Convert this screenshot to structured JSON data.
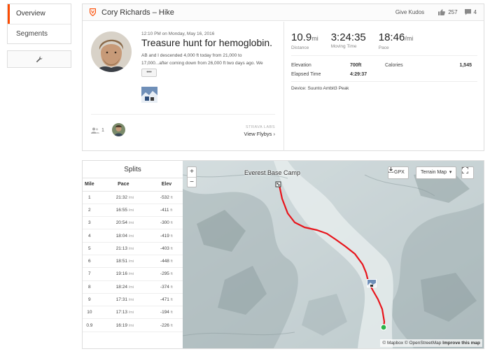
{
  "sidebar": {
    "items": [
      {
        "label": "Overview",
        "active": true
      },
      {
        "label": "Segments",
        "active": false
      }
    ],
    "tool_icon": "wrench-icon"
  },
  "activity": {
    "athlete": "Cory Richards",
    "type": "Hike",
    "title_sep": " – ",
    "kudos_label": "Give Kudos",
    "kudos_count": "257",
    "comment_count": "4",
    "datetime": "12:10 PM on Monday, May 16, 2016",
    "name": "Treasure hunt for hemoglobin.",
    "description_line1": "AB and I descended 4,000 ft today from 21,000 to",
    "description_line2": "17,000...after coming down from 26,000 ft two days ago. We",
    "more_label": "•••",
    "with_count": "1",
    "flyby_lab": "STRAVA LABS",
    "flyby_link": "View Flybys ›"
  },
  "stats": {
    "distance": {
      "value": "10.9",
      "unit": "mi",
      "label": "Distance"
    },
    "moving_time": {
      "value": "3:24:35",
      "label": "Moving Time"
    },
    "pace": {
      "value": "18:46",
      "unit": "/mi",
      "label": "Pace"
    },
    "elevation_label": "Elevation",
    "elevation_value": "700ft",
    "calories_label": "Calories",
    "calories_value": "1,545",
    "elapsed_label": "Elapsed Time",
    "elapsed_value": "4:29:37",
    "device": "Device: Suunto Ambit3 Peak"
  },
  "splits": {
    "title": "Splits",
    "headers": [
      "Mile",
      "Pace",
      "Elev"
    ],
    "pace_unit": "/mi",
    "elev_unit": "ft",
    "rows": [
      {
        "mile": "1",
        "pace": "21:32",
        "elev": "-532"
      },
      {
        "mile": "2",
        "pace": "16:55",
        "elev": "-411"
      },
      {
        "mile": "3",
        "pace": "20:54",
        "elev": "-300"
      },
      {
        "mile": "4",
        "pace": "18:04",
        "elev": "-419"
      },
      {
        "mile": "5",
        "pace": "21:13",
        "elev": "-403"
      },
      {
        "mile": "6",
        "pace": "18:51",
        "elev": "-448"
      },
      {
        "mile": "7",
        "pace": "19:16",
        "elev": "-295"
      },
      {
        "mile": "8",
        "pace": "18:24",
        "elev": "-374"
      },
      {
        "mile": "9",
        "pace": "17:31",
        "elev": "-471"
      },
      {
        "mile": "10",
        "pace": "17:13",
        "elev": "-194"
      },
      {
        "mile": "0.9",
        "pace": "16:19",
        "elev": "-226"
      }
    ]
  },
  "map": {
    "place_label": "Everest Base Camp",
    "zoom_in": "+",
    "zoom_out": "−",
    "gpx_label": "GPX",
    "terrain_label": "Terrain Map",
    "attribution_a": "© Mapbox © OpenStreetMap",
    "attribution_b": "Improve this map",
    "route_color": "#e8141b",
    "end_color": "#2bb34a"
  },
  "colors": {
    "accent": "#fc4c02"
  }
}
